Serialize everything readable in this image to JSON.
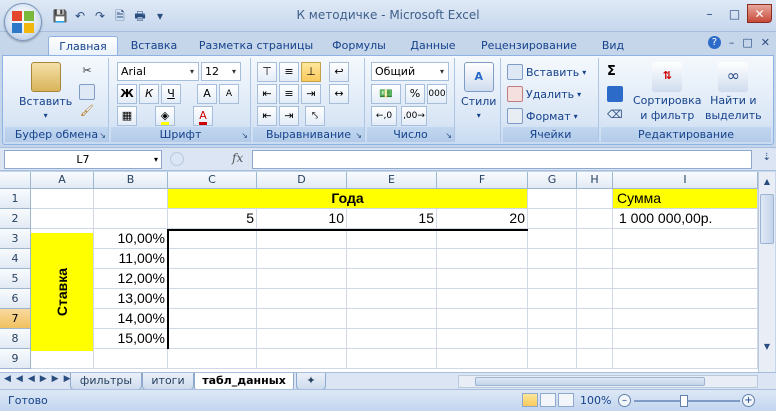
{
  "window": {
    "title": "К методичке - Microsoft Excel",
    "brand_color": "#1f497d"
  },
  "tabs": [
    "Главная",
    "Вставка",
    "Разметка страницы",
    "Формулы",
    "Данные",
    "Рецензирование",
    "Вид"
  ],
  "ribbon": {
    "clipboard": {
      "label": "Буфер обмена",
      "paste": "Вставить"
    },
    "font": {
      "label": "Шрифт",
      "name": "Arial",
      "size": "12",
      "bold": "Ж",
      "italic": "К",
      "underline": "Ч",
      "grow": "A",
      "shrink": "A"
    },
    "alignment": {
      "label": "Выравнивание"
    },
    "number": {
      "label": "Число",
      "format": "Общий",
      "percent": "%",
      "thousands": "000"
    },
    "styles": {
      "label": "Стили"
    },
    "cells": {
      "label": "Ячейки",
      "insert": "Вставить",
      "delete": "Удалить",
      "format": "Формат"
    },
    "editing": {
      "label": "Редактирование",
      "sort1": "Сортировка",
      "sort2": "и фильтр",
      "find1": "Найти и",
      "find2": "выделить"
    }
  },
  "formula_bar": {
    "name_box": "L7",
    "fx": "fx",
    "value": ""
  },
  "columns": [
    "A",
    "B",
    "C",
    "D",
    "E",
    "F",
    "G",
    "H",
    "I"
  ],
  "rows": [
    "1",
    "2",
    "3",
    "4",
    "5",
    "6",
    "7",
    "8",
    "9"
  ],
  "selected_row": "7",
  "cells": {
    "years_title": "Года",
    "sum_label": "Сумма",
    "years": [
      "5",
      "10",
      "15",
      "20"
    ],
    "sum_value": "1 000 000,00р.",
    "rate_label": "Ставка",
    "rates": [
      "10,00%",
      "11,00%",
      "12,00%",
      "13,00%",
      "14,00%",
      "15,00%"
    ]
  },
  "sheets": [
    "фильтры",
    "итоги",
    "табл_данных"
  ],
  "active_sheet": "табл_данных",
  "status": {
    "ready": "Готово",
    "zoom": "100%"
  }
}
